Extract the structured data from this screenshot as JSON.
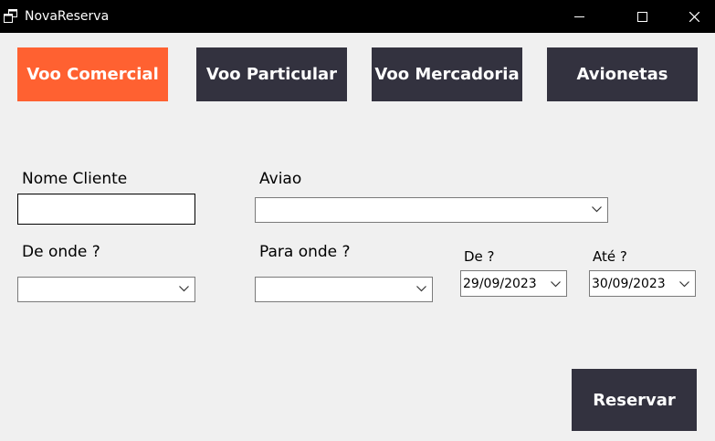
{
  "window": {
    "title": "NovaReserva",
    "app_icon": "windows-app-icon",
    "controls": {
      "minimize_icon": "minimize-icon",
      "maximize_icon": "maximize-icon",
      "close_icon": "close-icon"
    }
  },
  "tabs": [
    {
      "label": "Voo Comercial",
      "active": true
    },
    {
      "label": "Voo Particular",
      "active": false
    },
    {
      "label": "Voo Mercadoria",
      "active": false
    },
    {
      "label": "Avionetas",
      "active": false
    }
  ],
  "form": {
    "nome_cliente": {
      "label": "Nome Cliente",
      "value": ""
    },
    "aviao": {
      "label": "Aviao",
      "selected": ""
    },
    "de_onde": {
      "label": "De onde ?",
      "selected": ""
    },
    "para_onde": {
      "label": "Para onde ?",
      "selected": ""
    },
    "data_de": {
      "label": "De ?",
      "value": "29/09/2023"
    },
    "data_ate": {
      "label": "Até ?",
      "value": "30/09/2023"
    }
  },
  "actions": {
    "reservar_label": "Reservar"
  },
  "colors": {
    "titlebar": "#000000",
    "window_bg": "#f0f0f0",
    "active_tab": "#ff6131",
    "inactive_tab": "#33323f",
    "button_dark": "#33323f",
    "text_on_dark": "#ffffff"
  }
}
